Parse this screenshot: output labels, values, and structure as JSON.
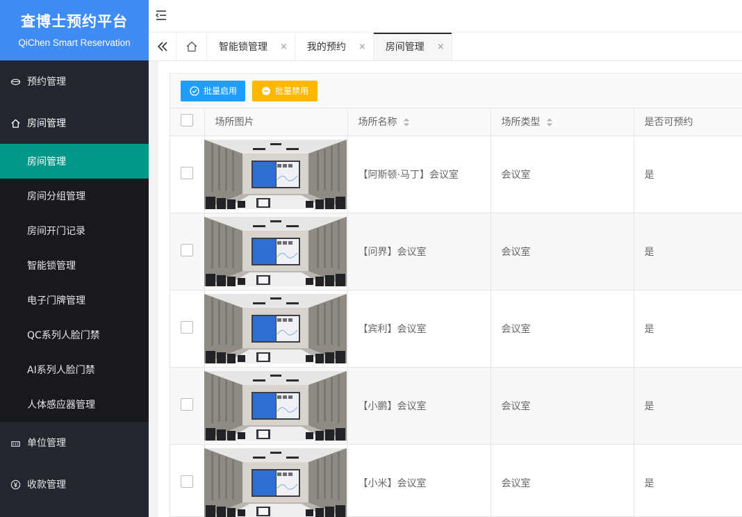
{
  "brand": {
    "title": "查博士预约平台",
    "subtitle": "QiChen Smart Reservation"
  },
  "sidebar": {
    "reservation": "预约管理",
    "room": "房间管理",
    "room_sub": [
      "房间管理",
      "房间分组管理",
      "房间开门记录",
      "智能锁管理",
      "电子门牌管理",
      "QC系列人脸门禁",
      "AI系列人脸门禁",
      "人体感应器管理"
    ],
    "unit": "单位管理",
    "payment": "收款管理"
  },
  "tabs": [
    {
      "label": "智能锁管理",
      "close": "×"
    },
    {
      "label": "我的预约",
      "close": "×"
    },
    {
      "label": "房间管理",
      "close": "×"
    }
  ],
  "toolbar": {
    "enable_label": "批量启用",
    "disable_label": "批量禁用"
  },
  "table": {
    "headers": [
      "场所图片",
      "场所名称",
      "场所类型",
      "是否可预约"
    ],
    "rows": [
      {
        "name": "【阿斯顿·马丁】会议室",
        "type": "会议室",
        "bookable": "是"
      },
      {
        "name": "【问界】会议室",
        "type": "会议室",
        "bookable": "是"
      },
      {
        "name": "【宾利】会议室",
        "type": "会议室",
        "bookable": "是"
      },
      {
        "name": "【小鹏】会议室",
        "type": "会议室",
        "bookable": "是"
      },
      {
        "name": "【小米】会议室",
        "type": "会议室",
        "bookable": "是"
      }
    ]
  },
  "colors": {
    "brand": "#3f8cf6",
    "active": "#009688",
    "sidebar": "#23262e",
    "btn_blue": "#1e9fff",
    "btn_orange": "#ffb800"
  }
}
